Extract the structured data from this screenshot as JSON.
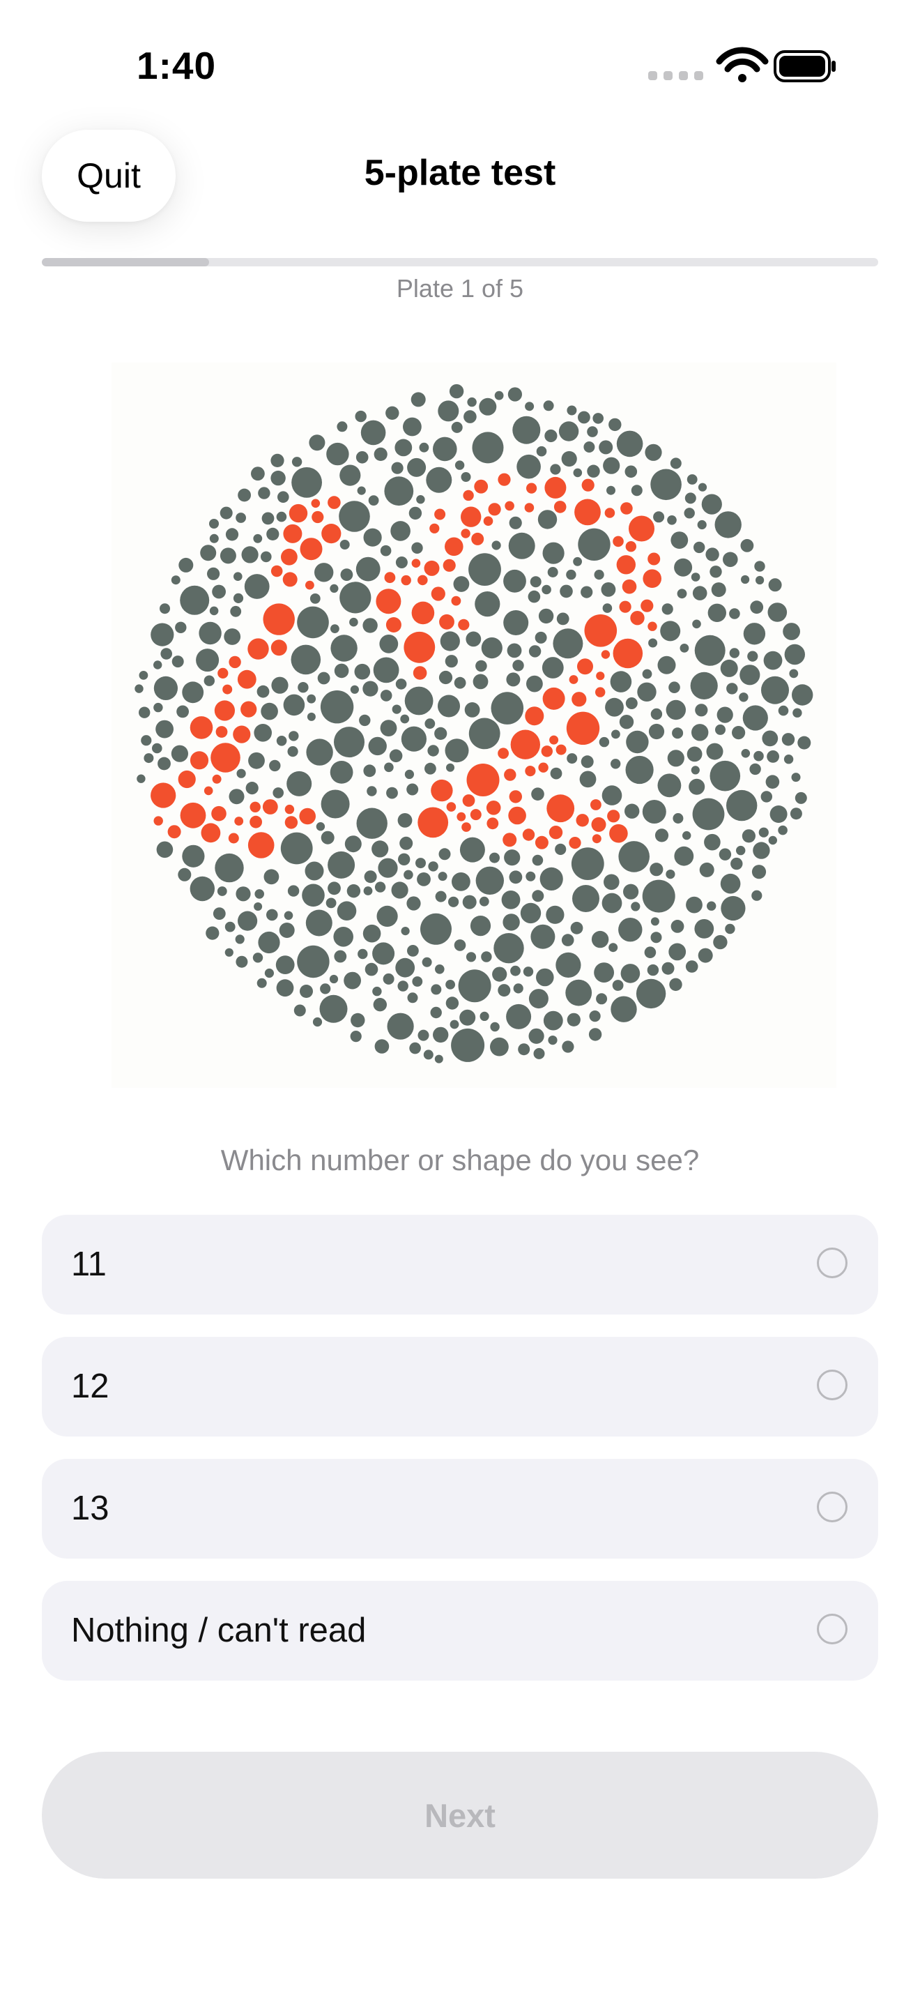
{
  "status_bar": {
    "time": "1:40",
    "icons": [
      "cellular-signal-icon",
      "wifi-icon",
      "battery-icon"
    ]
  },
  "nav": {
    "quit_label": "Quit",
    "title": "5-plate test"
  },
  "progress": {
    "label": "Plate 1 of 5",
    "current": 1,
    "total": 5,
    "fraction": 0.2
  },
  "plate": {
    "figure_number": "12",
    "background_dot_color": "#5e6b66",
    "figure_dot_color": "#f2502d"
  },
  "question": "Which number or shape do you see?",
  "options": [
    {
      "label": "11"
    },
    {
      "label": "12"
    },
    {
      "label": "13"
    },
    {
      "label": "Nothing / can't read"
    }
  ],
  "next_label": "Next",
  "colors": {
    "accent_disabled": "#b8b8bc",
    "option_background": "#f2f2f7",
    "secondary_text": "#8a8a8e"
  }
}
